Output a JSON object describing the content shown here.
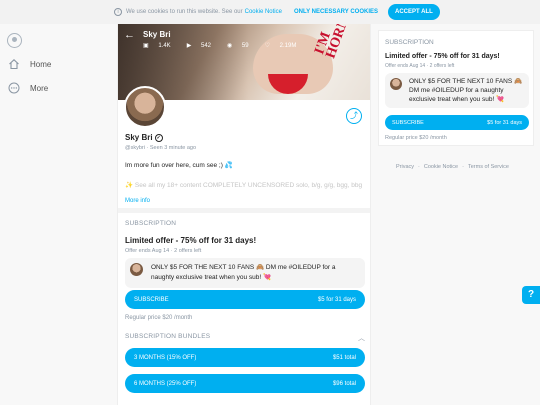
{
  "cookie_bar": {
    "text": "We use cookies to run this website. See our",
    "link": "Cookie Notice",
    "necessary_label": "ONLY NECESSARY COOKIES",
    "accept_label": "ACCEPT ALL"
  },
  "sidebar": {
    "items": [
      {
        "label": "Home",
        "icon": "home-icon"
      },
      {
        "label": "More",
        "icon": "more-icon"
      }
    ]
  },
  "profile": {
    "name": "Sky Bri",
    "stats": {
      "photos": "1.4K",
      "videos": "542",
      "streams": "59",
      "likes": "2.19M"
    },
    "handle": "@skybri",
    "seen": "Seen 3 minute ago",
    "bio": "Im more fun over here, cum see ;) 💦",
    "bio_line2": "✨ See all my 18+ content COMPLETELY UNCENSORED solo, b/g, g/g, bgg, bbg",
    "more_info": "More info"
  },
  "subscription": {
    "title": "Subscription",
    "offer_title": "Limited offer - 75% off for 31 days!",
    "offer_meta": "Offer ends Aug 14 · 2 offers left",
    "promo": "ONLY $5 FOR THE NEXT 10 FANS 🙈 DM me #OILEDUP for a naughty exclusive treat when you sub! 💘",
    "button_label": "Subscribe",
    "button_price": "$5 for 31 days",
    "regular_price": "Regular price $20 /month"
  },
  "bundles": {
    "title": "Subscription bundles",
    "items": [
      {
        "label": "3 MONTHS (15% off)",
        "price": "$51 total"
      },
      {
        "label": "6 MONTHS (25% off)",
        "price": "$96 total"
      }
    ]
  },
  "right_card": {
    "title": "Subscription",
    "offer_title": "Limited offer - 75% off for 31 days!",
    "offer_meta": "Offer ends Aug 14 · 2 offers left",
    "promo": "ONLY $5 FOR THE NEXT 10 FANS 🙈 DM me #OILEDUP for a naughty exclusive treat when you sub! 💘",
    "button_label": "SUBSCRIBE",
    "button_price": "$5 for 31 days",
    "regular_price": "Regular price $20 /month"
  },
  "footer": {
    "privacy": "Privacy",
    "sep": "·",
    "cookie": "Cookie Notice",
    "terms": "Terms of Service"
  },
  "colors": {
    "accent": "#00aff0",
    "muted": "#8a96a3"
  }
}
